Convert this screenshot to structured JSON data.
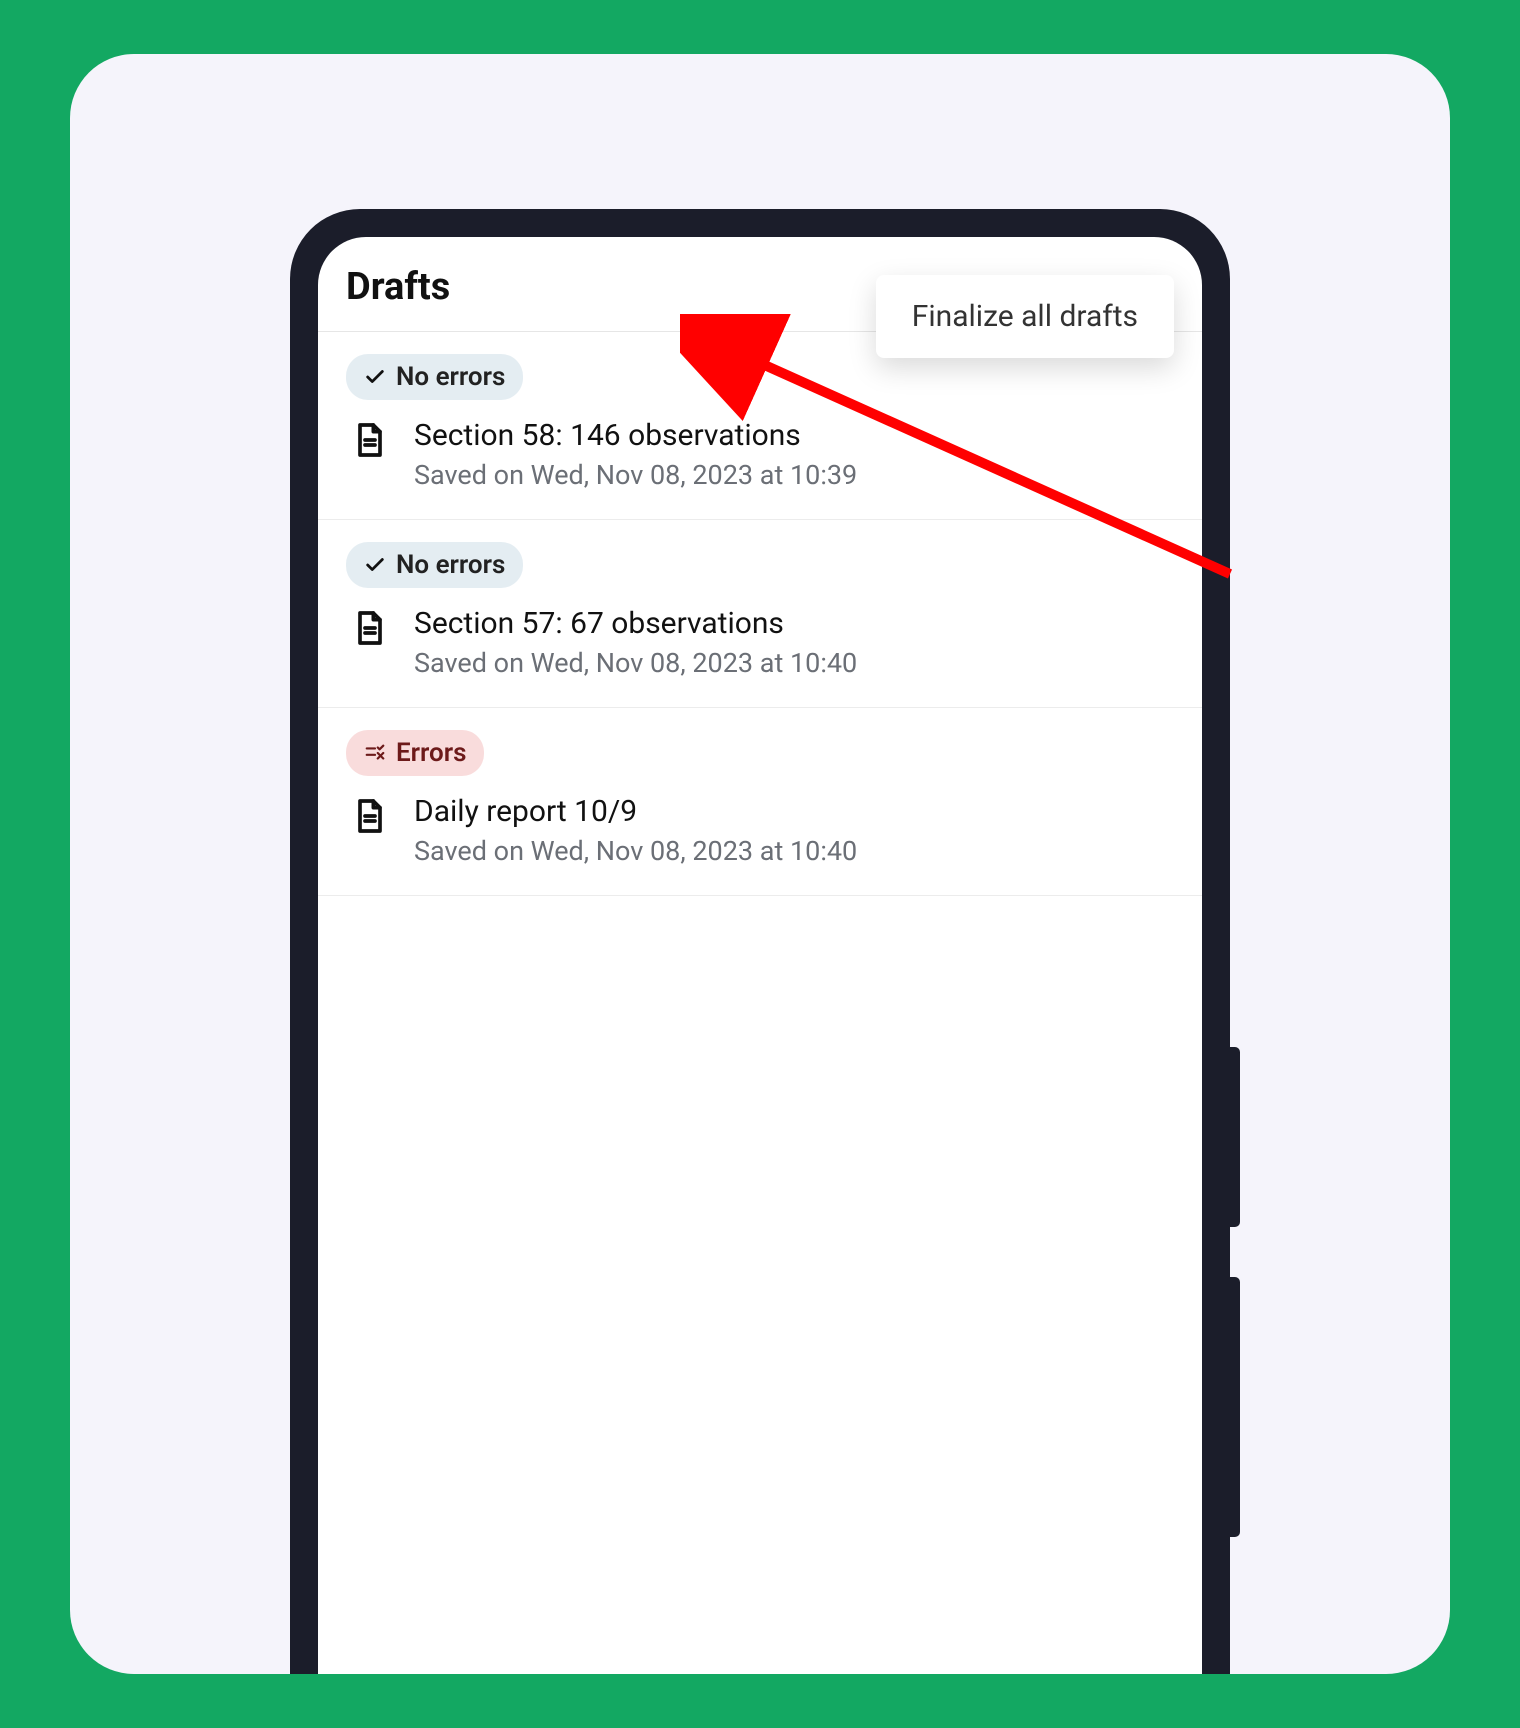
{
  "header": {
    "title": "Drafts"
  },
  "dropdown": {
    "items": [
      {
        "label": "Finalize all drafts"
      }
    ]
  },
  "status_labels": {
    "no_errors": "No errors",
    "errors": "Errors"
  },
  "drafts": [
    {
      "status": "no_errors",
      "title": "Section 58: 146 observations",
      "saved": "Saved on Wed, Nov 08, 2023 at 10:39"
    },
    {
      "status": "no_errors",
      "title": "Section 57: 67 observations",
      "saved": "Saved on Wed, Nov 08, 2023 at 10:40"
    },
    {
      "status": "errors",
      "title": "Daily report 10/9",
      "saved": "Saved on Wed, Nov 08, 2023 at 10:40"
    }
  ],
  "colors": {
    "page_bg": "#f5f4fb",
    "phone_frame": "#1b1d2a",
    "arrow": "#ff0000"
  }
}
